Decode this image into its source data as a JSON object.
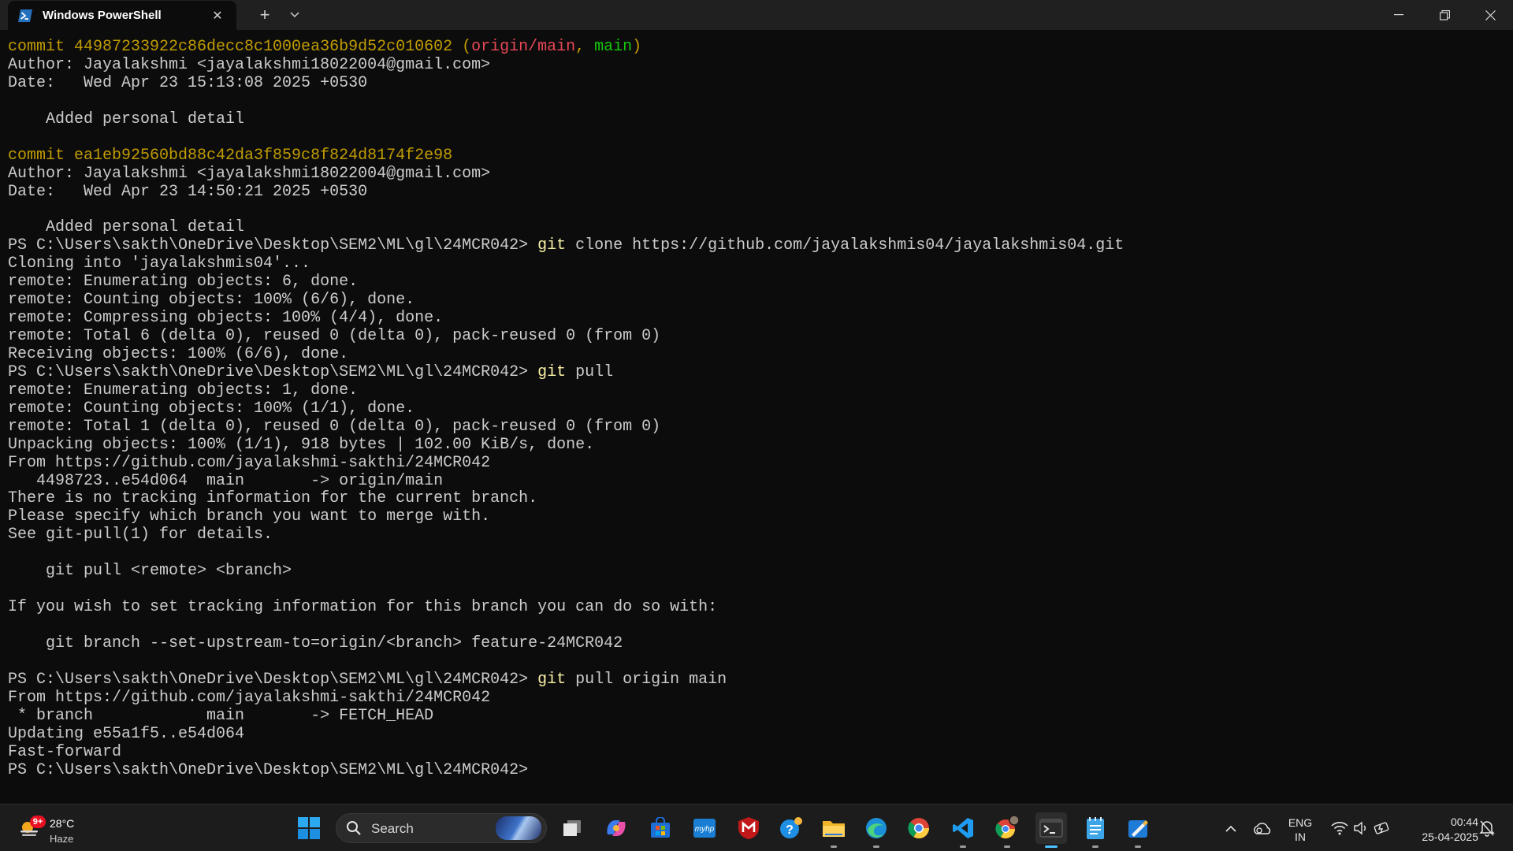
{
  "window": {
    "tab_title": "Windows PowerShell",
    "icons": {
      "app": "powershell-icon",
      "tab_close": "close-icon",
      "new_tab": "plus-icon",
      "dropdown": "chevron-down-icon",
      "minimize": "minimize-icon",
      "maximize": "restore-icon",
      "close": "close-icon"
    }
  },
  "terminal": {
    "lines": [
      {
        "segments": [
          {
            "t": "commit 44987233922c86decc8c1000ea36b9d52c010602 ",
            "c": "yellow"
          },
          {
            "t": "(",
            "c": "yellow"
          },
          {
            "t": "origin/main",
            "c": "red"
          },
          {
            "t": ", ",
            "c": "yellow"
          },
          {
            "t": "main",
            "c": "green"
          },
          {
            "t": ")",
            "c": "yellow"
          }
        ]
      },
      {
        "segments": [
          {
            "t": "Author: Jayalakshmi <jayalakshmi18022004@gmail.com>"
          }
        ]
      },
      {
        "segments": [
          {
            "t": "Date:   Wed Apr 23 15:13:08 2025 +0530"
          }
        ]
      },
      {
        "segments": [
          {
            "t": ""
          }
        ]
      },
      {
        "segments": [
          {
            "t": "    Added personal detail"
          }
        ]
      },
      {
        "segments": [
          {
            "t": ""
          }
        ]
      },
      {
        "segments": [
          {
            "t": "commit ea1eb92560bd88c42da3f859c8f824d8174f2e98",
            "c": "yellow"
          }
        ]
      },
      {
        "segments": [
          {
            "t": "Author: Jayalakshmi <jayalakshmi18022004@gmail.com>"
          }
        ]
      },
      {
        "segments": [
          {
            "t": "Date:   Wed Apr 23 14:50:21 2025 +0530"
          }
        ]
      },
      {
        "segments": [
          {
            "t": ""
          }
        ]
      },
      {
        "segments": [
          {
            "t": "    Added personal detail"
          }
        ]
      },
      {
        "segments": [
          {
            "t": "PS C:\\Users\\sakth\\OneDrive\\Desktop\\SEM2\\ML\\gl\\24MCR042> "
          },
          {
            "t": "git",
            "c": "cmd"
          },
          {
            "t": " clone https://github.com/jayalakshmis04/jayalakshmis04.git"
          }
        ]
      },
      {
        "segments": [
          {
            "t": "Cloning into 'jayalakshmis04'..."
          }
        ]
      },
      {
        "segments": [
          {
            "t": "remote: Enumerating objects: 6, done."
          }
        ]
      },
      {
        "segments": [
          {
            "t": "remote: Counting objects: 100% (6/6), done."
          }
        ]
      },
      {
        "segments": [
          {
            "t": "remote: Compressing objects: 100% (4/4), done."
          }
        ]
      },
      {
        "segments": [
          {
            "t": "remote: Total 6 (delta 0), reused 0 (delta 0), pack-reused 0 (from 0)"
          }
        ]
      },
      {
        "segments": [
          {
            "t": "Receiving objects: 100% (6/6), done."
          }
        ]
      },
      {
        "segments": [
          {
            "t": "PS C:\\Users\\sakth\\OneDrive\\Desktop\\SEM2\\ML\\gl\\24MCR042> "
          },
          {
            "t": "git",
            "c": "cmd"
          },
          {
            "t": " pull"
          }
        ]
      },
      {
        "segments": [
          {
            "t": "remote: Enumerating objects: 1, done."
          }
        ]
      },
      {
        "segments": [
          {
            "t": "remote: Counting objects: 100% (1/1), done."
          }
        ]
      },
      {
        "segments": [
          {
            "t": "remote: Total 1 (delta 0), reused 0 (delta 0), pack-reused 0 (from 0)"
          }
        ]
      },
      {
        "segments": [
          {
            "t": "Unpacking objects: 100% (1/1), 918 bytes | 102.00 KiB/s, done."
          }
        ]
      },
      {
        "segments": [
          {
            "t": "From https://github.com/jayalakshmi-sakthi/24MCR042"
          }
        ]
      },
      {
        "segments": [
          {
            "t": "   4498723..e54d064  main       -> origin/main"
          }
        ]
      },
      {
        "segments": [
          {
            "t": "There is no tracking information for the current branch."
          }
        ]
      },
      {
        "segments": [
          {
            "t": "Please specify which branch you want to merge with."
          }
        ]
      },
      {
        "segments": [
          {
            "t": "See git-pull(1) for details."
          }
        ]
      },
      {
        "segments": [
          {
            "t": ""
          }
        ]
      },
      {
        "segments": [
          {
            "t": "    git pull <remote> <branch>"
          }
        ]
      },
      {
        "segments": [
          {
            "t": ""
          }
        ]
      },
      {
        "segments": [
          {
            "t": "If you wish to set tracking information for this branch you can do so with:"
          }
        ]
      },
      {
        "segments": [
          {
            "t": ""
          }
        ]
      },
      {
        "segments": [
          {
            "t": "    git branch --set-upstream-to=origin/<branch> feature-24MCR042"
          }
        ]
      },
      {
        "segments": [
          {
            "t": ""
          }
        ]
      },
      {
        "segments": [
          {
            "t": "PS C:\\Users\\sakth\\OneDrive\\Desktop\\SEM2\\ML\\gl\\24MCR042> "
          },
          {
            "t": "git",
            "c": "cmd"
          },
          {
            "t": " pull origin main"
          }
        ]
      },
      {
        "segments": [
          {
            "t": "From https://github.com/jayalakshmi-sakthi/24MCR042"
          }
        ]
      },
      {
        "segments": [
          {
            "t": " * branch            main       -> FETCH_HEAD"
          }
        ]
      },
      {
        "segments": [
          {
            "t": "Updating e55a1f5..e54d064"
          }
        ]
      },
      {
        "segments": [
          {
            "t": "Fast-forward"
          }
        ]
      },
      {
        "segments": [
          {
            "t": "PS C:\\Users\\sakth\\OneDrive\\Desktop\\SEM2\\ML\\gl\\24MCR042> "
          }
        ]
      }
    ]
  },
  "taskbar": {
    "weather": {
      "badge": "9+",
      "temp": "28°C",
      "condition": "Haze",
      "icon": "sun-haze-icon"
    },
    "search": {
      "placeholder": "Search",
      "icon": "search-icon"
    },
    "pinned": [
      {
        "name": "start-button",
        "icon": "windows-start-icon"
      },
      {
        "name": "task-view-button",
        "icon": "task-view-icon"
      },
      {
        "name": "copilot-button",
        "icon": "copilot-icon"
      },
      {
        "name": "microsoft-store-button",
        "icon": "store-icon"
      },
      {
        "name": "myhp-button",
        "icon": "myhp-icon",
        "label": "myhp"
      },
      {
        "name": "mcafee-button",
        "icon": "mcafee-icon"
      },
      {
        "name": "get-help-button",
        "icon": "help-icon"
      },
      {
        "name": "file-explorer-button",
        "icon": "folder-icon"
      },
      {
        "name": "edge-button",
        "icon": "edge-icon"
      },
      {
        "name": "chrome-button",
        "icon": "chrome-icon"
      },
      {
        "name": "vscode-button",
        "icon": "vscode-icon"
      },
      {
        "name": "chrome-profile-button",
        "icon": "chrome-profile-icon"
      },
      {
        "name": "terminal-button",
        "icon": "terminal-icon"
      },
      {
        "name": "notepad-button",
        "icon": "notepad-icon"
      },
      {
        "name": "paint-button",
        "icon": "paint-icon"
      }
    ],
    "tray": {
      "lang_top": "ENG",
      "lang_bottom": "IN",
      "time": "00:44",
      "date": "25-04-2025",
      "icons": [
        "chevron-up-icon",
        "onedrive-icon",
        "wifi-icon",
        "volume-icon",
        "battery-icon",
        "notification-bell-icon"
      ]
    }
  },
  "colors": {
    "terminal_bg": "#0c0c0c",
    "text": "#cccccc",
    "commit_yellow": "#c19c00",
    "branch_red": "#e74856",
    "branch_green": "#16c60c",
    "command_yellow": "#f9f1a5",
    "taskbar_bg": "#1c1c1c",
    "accent": "#4cc2ff"
  }
}
